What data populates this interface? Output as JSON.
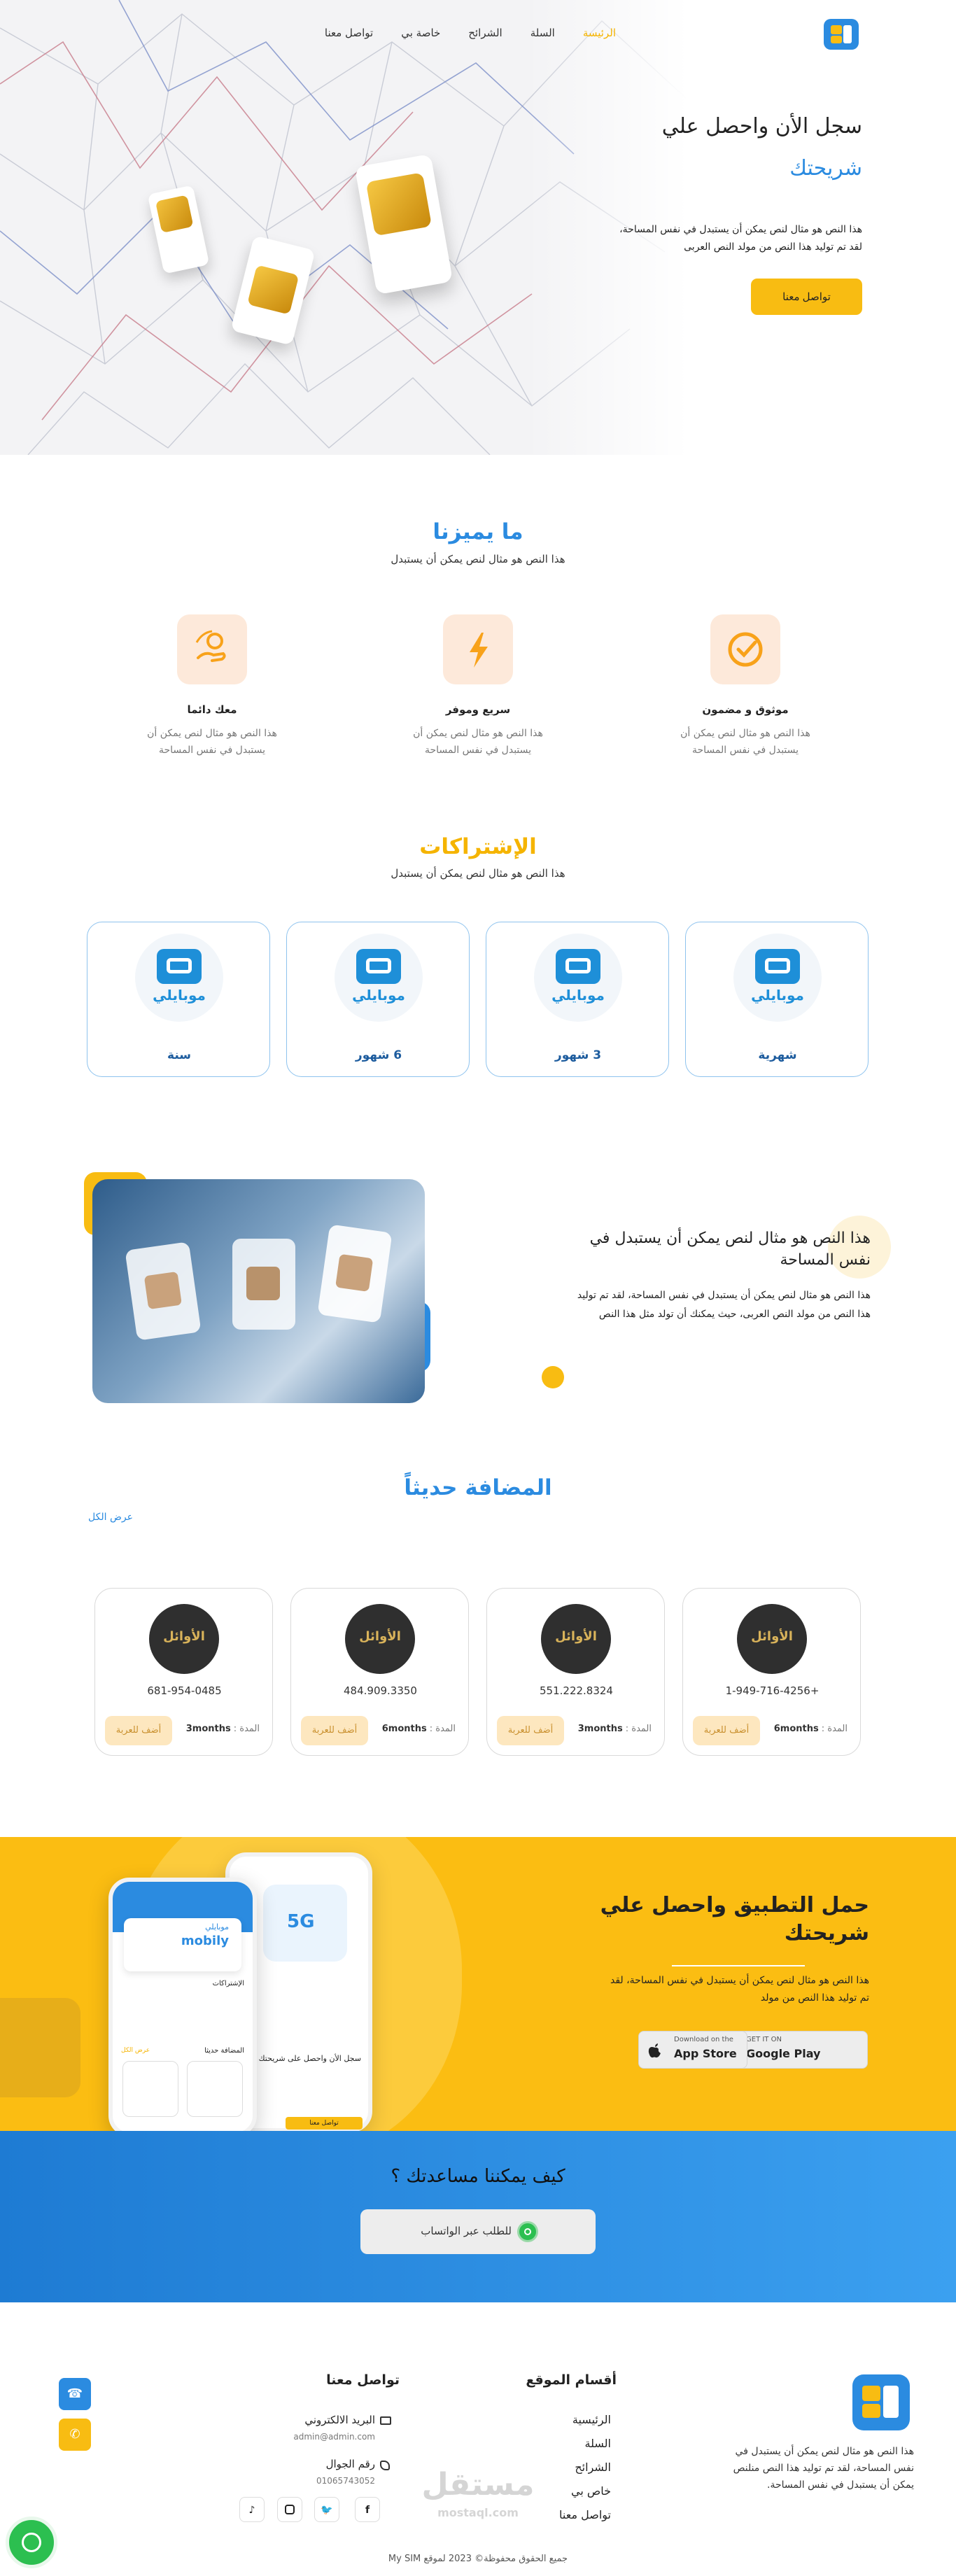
{
  "header": {
    "nav": [
      {
        "label": "الرئيسة",
        "active": true
      },
      {
        "label": "السلة"
      },
      {
        "label": "الشرائح"
      },
      {
        "label": "خاصة بي"
      },
      {
        "label": "تواصل معنا"
      }
    ]
  },
  "hero": {
    "title": "سجل الأن واحصل علي",
    "title_accent": "شريحتك",
    "text_line1": "هذا النص هو مثال لنص يمكن أن يستبدل في نفس المساحة،",
    "text_line2": "لقد تم توليد هذا النص من مولد النص العربى",
    "cta": "تواصل معنا"
  },
  "features": {
    "title": "ما يميزنا",
    "subtitle": "هذا النص هو مثال لنص يمكن أن يستبدل",
    "items": [
      {
        "title": "موثوق و مضمون",
        "text1": "هذا النص هو مثال لنص يمكن أن",
        "text2": "يستبدل في نفس المساحة",
        "icon": "check-badge-icon"
      },
      {
        "title": "سريع وموفر",
        "text1": "هذا النص هو مثال لنص يمكن أن",
        "text2": "يستبدل في نفس المساحة",
        "icon": "lightning-icon"
      },
      {
        "title": "معك دائما",
        "text1": "هذا النص هو مثال لنص يمكن أن",
        "text2": "يستبدل في نفس المساحة",
        "icon": "support-hand-icon"
      }
    ]
  },
  "subscriptions": {
    "title": "الإشتراكات",
    "subtitle": "هذا النص هو مثال لنص يمكن أن يستبدل",
    "logo_text": "موبايلي",
    "items": [
      {
        "label": "شهرية"
      },
      {
        "label": "3 شهور"
      },
      {
        "label": "6 شهور"
      },
      {
        "label": "سنة"
      }
    ]
  },
  "about": {
    "title_line1": "هذا النص هو مثال لنص يمكن أن يستبدل في",
    "title_line2": "نفس المساحة",
    "text_line1": "هذا النص هو مثال لنص يمكن أن يستبدل في نفس المساحة، لقد تم توليد",
    "text_line2": "هذا النص من مولد النص العربى، حيث يمكنك أن تولد مثل هذا النص"
  },
  "recent": {
    "title": "المضافة حديثاً",
    "view_all": "عرض الكل",
    "duration_label": "المدة :",
    "button": "أضف للعربة",
    "logo_text": "الأوائل",
    "items": [
      {
        "phone": "+1-949-716-4256",
        "duration": "6months"
      },
      {
        "phone": "551.222.8324",
        "duration": "3months"
      },
      {
        "phone": "484.909.3350",
        "duration": "6months"
      },
      {
        "phone": "681-954-0485",
        "duration": "3months"
      }
    ]
  },
  "app": {
    "title_line1": "حمل التطبيق واحصل علي",
    "title_line2": "شريحتك",
    "text_line1": "هذا النص هو مثال لنص يمكن أن يستبدل في نفس المساحة، لقد",
    "text_line2": "تم توليد هذا النص من مولد",
    "google_small": "GET IT ON",
    "google_big": "Google Play",
    "apple_small": "Download on the",
    "apple_big": "App Store",
    "phone1_brand": "mobily",
    "phone1_brand_ar": "موبايلي",
    "phone1_section": "الإشتراكات",
    "phone1_recent": "المضافة حديثا",
    "phone1_viewall": "عرض الكل",
    "phone2_badge": "5G",
    "phone2_title": "سجل الأن واحصل على شريحتك",
    "phone2_btn": "تواصل معنا"
  },
  "help": {
    "title": "كيف يمكننا مساعدتك ؟",
    "button": "للطلب عبر الواتساب"
  },
  "footer": {
    "about_text1": "هذا النص هو مثال لنص يمكن أن يستبدل في",
    "about_text2": "نفس المساحة، لقد تم توليد هذا النص منلنص",
    "about_text3": "يمكن أن يستبدل في نفس المساحة.",
    "sections_title": "أقسام الموقع",
    "links": [
      "الرئيسية",
      "السلة",
      "الشرائح",
      "خاص بي",
      "تواصل معنا"
    ],
    "contact_title": "تواصل معنا",
    "email_label": "البريد الالكتروني",
    "email": "admin@admin.com",
    "phone_label": "رقم الجوال",
    "phone": "01065743052",
    "copyright": "جميع الحقوق محفوظة© 2023 لموقع My SIM",
    "watermark_ar": "مستقل",
    "watermark_en": "mostaql.com"
  },
  "colors": {
    "yellow": "#F8BC12",
    "blue": "#2B8BE0",
    "dark": "#1D5C9E"
  }
}
